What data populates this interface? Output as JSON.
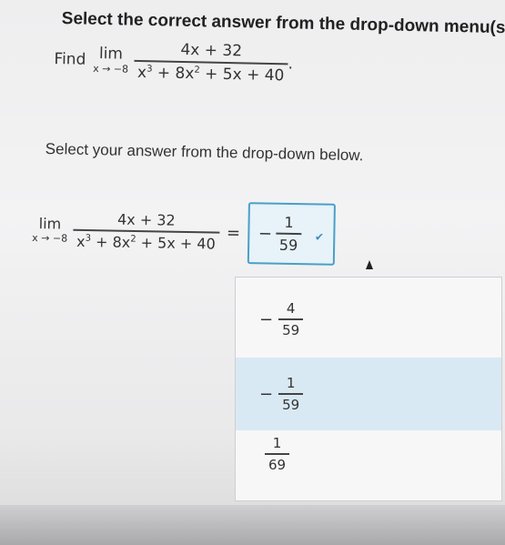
{
  "title": "Select the correct answer from the drop-down menu(s).",
  "question": {
    "find": "Find",
    "lim": "lim",
    "lim_sub": "x → −8",
    "numerator": "4x + 32",
    "den_a": "x",
    "den_a_exp": "3",
    "den_b": " + 8x",
    "den_b_exp": "2",
    "den_c": " + 5x + 40",
    "period": "."
  },
  "instruction": "Select your answer from the drop-down below.",
  "answer": {
    "lim": "lim",
    "lim_sub": "x → −8",
    "numerator": "4x + 32",
    "den_a": "x",
    "den_a_exp": "3",
    "den_b": " + 8x",
    "den_b_exp": "2",
    "den_c": " + 5x + 40",
    "equals": "=",
    "selected": {
      "sign": "−",
      "num": "1",
      "den": "59"
    }
  },
  "options": [
    {
      "sign": "−",
      "num": "4",
      "den": "59"
    },
    {
      "sign": "−",
      "num": "1",
      "den": "59"
    },
    {
      "sign": "",
      "num": "1",
      "den": "69"
    }
  ],
  "icons": {
    "dropdown": "chevron-down-icon",
    "pointer": "cursor-icon"
  },
  "colors": {
    "accent": "#48a0c8",
    "highlight": "#d9e9f3"
  }
}
